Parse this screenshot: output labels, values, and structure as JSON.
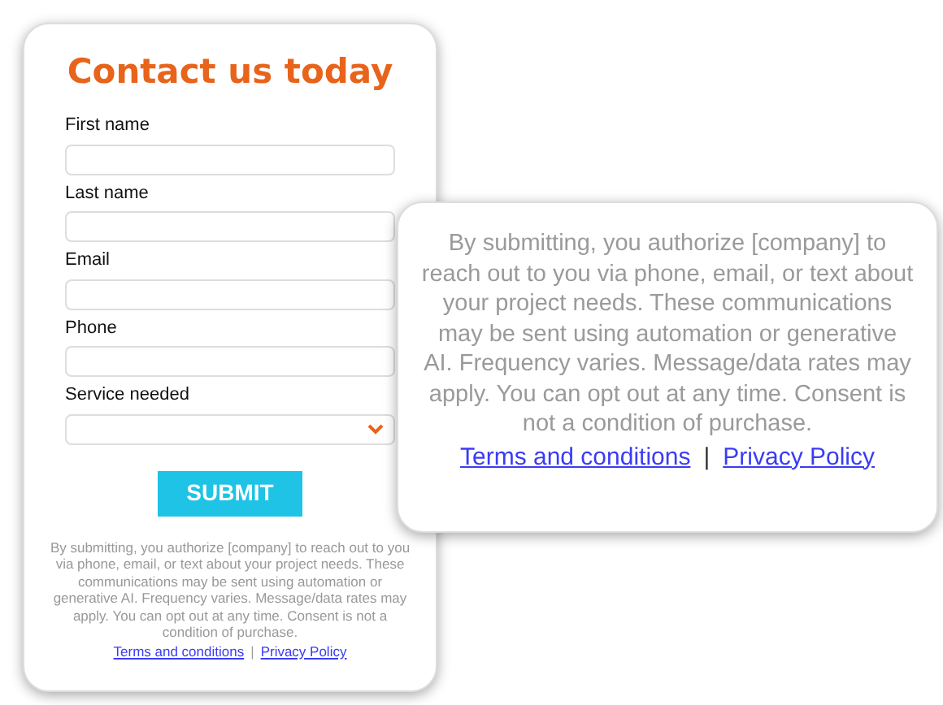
{
  "form": {
    "title": "Contact us today",
    "fields": [
      {
        "kind": "text",
        "label": "First name"
      },
      {
        "kind": "text",
        "label": "Last name"
      },
      {
        "kind": "text",
        "label": "Email"
      },
      {
        "kind": "text",
        "label": "Phone"
      },
      {
        "kind": "select",
        "label": "Service needed"
      }
    ],
    "submit": "SUBMIT",
    "disclaimer": "By submitting, you authorize [company] to reach out to you via phone, email, or text about your project needs. These communications may be sent using automation or generative AI. Frequency varies. Message/data rates may apply. You can opt out at any time. Consent is not a condition of purchase.",
    "links": [
      "Terms and conditions",
      "Privacy Policy"
    ],
    "separator": "|"
  },
  "callout": {
    "disclaimer": "By submitting, you authorize [company] to reach out to you via phone, email, or text about your project needs. These communications may be sent using automation or generative AI. Frequency varies. Message/data rates may apply. You can opt out at any time. Consent is not a condition of purchase.",
    "links": [
      "Terms and conditions",
      "Privacy Policy"
    ],
    "separator": "|"
  }
}
